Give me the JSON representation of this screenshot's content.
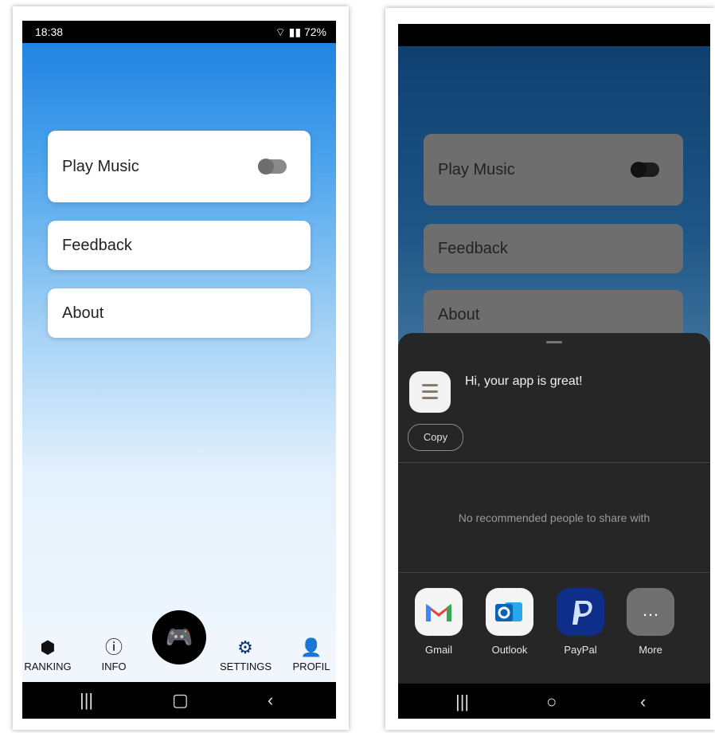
{
  "left": {
    "status": {
      "time": "18:38",
      "battery": "72%"
    },
    "cards": {
      "play_music": "Play Music",
      "feedback": "Feedback",
      "about": "About"
    },
    "tabs": {
      "ranking": "RANKING",
      "info": "INFO",
      "settings": "SETTINGS",
      "profil": "PROFIL"
    },
    "accent": "#1a7de0"
  },
  "right": {
    "cards": {
      "play_music": "Play Music",
      "feedback": "Feedback",
      "about": "About"
    },
    "share": {
      "message": "Hi, your app is great!",
      "copy_label": "Copy",
      "no_recommendation": "No recommended people to share with",
      "apps": [
        "Gmail",
        "Outlook",
        "PayPal",
        "More"
      ]
    }
  }
}
